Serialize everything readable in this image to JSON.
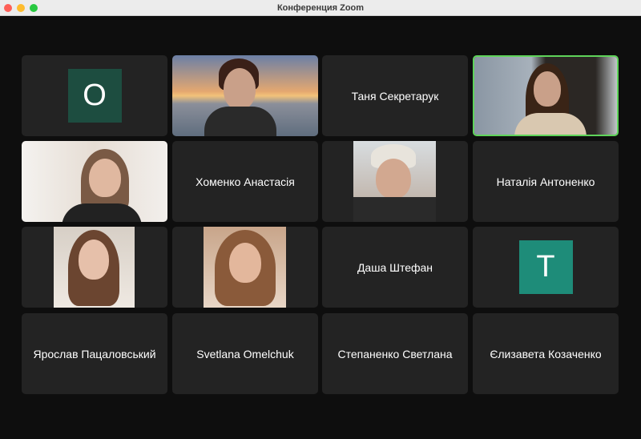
{
  "window": {
    "title": "Конференция Zoom"
  },
  "accent": {
    "active_speaker": "#5fd45a",
    "avatar_o": "#1d4d40",
    "avatar_t": "#1e8c79"
  },
  "participants": [
    {
      "type": "avatar",
      "initial": "O"
    },
    {
      "type": "video"
    },
    {
      "type": "name",
      "name": "Таня Секретарук"
    },
    {
      "type": "video",
      "active": true
    },
    {
      "type": "video"
    },
    {
      "type": "name",
      "name": "Хоменко Анастасія"
    },
    {
      "type": "video"
    },
    {
      "type": "name",
      "name": "Наталія Антоненко"
    },
    {
      "type": "video"
    },
    {
      "type": "video"
    },
    {
      "type": "name",
      "name": "Даша Штефан"
    },
    {
      "type": "avatar",
      "initial": "T"
    },
    {
      "type": "name",
      "name": "Ярослав Пацаловський"
    },
    {
      "type": "name",
      "name": "Svetlana Omelchuk"
    },
    {
      "type": "name",
      "name": "Степаненко Светлана"
    },
    {
      "type": "name",
      "name": "Єлизавета Козаченко"
    }
  ]
}
